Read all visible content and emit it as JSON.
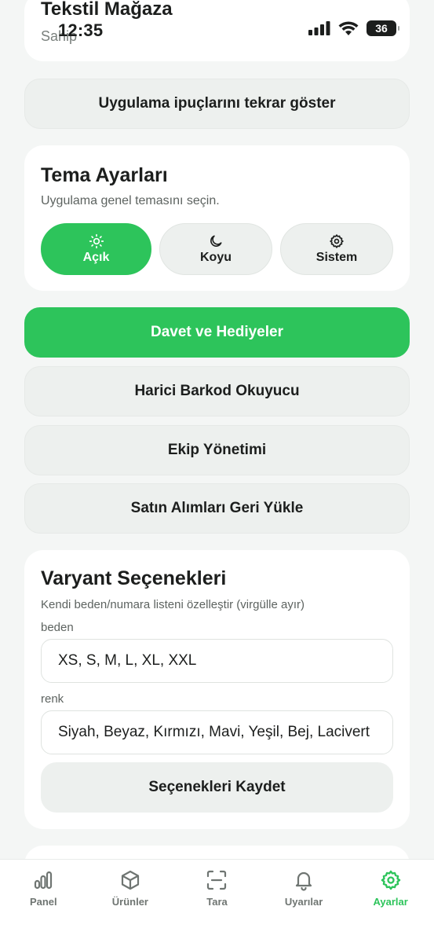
{
  "status": {
    "time": "12:35",
    "battery": "36"
  },
  "header": {
    "store_name": "Tekstil Mağaza",
    "role": "Sahip"
  },
  "tips_button": "Uygulama ipuçlarını tekrar göster",
  "theme": {
    "title": "Tema Ayarları",
    "subtitle": "Uygulama genel temasını seçin.",
    "options": [
      {
        "label": "Açık",
        "icon": "sun-icon",
        "selected": true
      },
      {
        "label": "Koyu",
        "icon": "moon-icon",
        "selected": false
      },
      {
        "label": "Sistem",
        "icon": "gear-icon",
        "selected": false
      }
    ]
  },
  "menu": {
    "invite": "Davet ve Hediyeler",
    "barcode": "Harici Barkod Okuyucu",
    "team": "Ekip Yönetimi",
    "restore": "Satın Alımları Geri Yükle"
  },
  "variants": {
    "title": "Varyant Seçenekleri",
    "subtitle": "Kendi beden/numara listeni özelleştir (virgülle ayır)",
    "size_label": "beden",
    "size_value": "XS, S, M, L, XL, XXL",
    "color_label": "renk",
    "color_value": "Siyah, Beyaz, Kırmızı, Mavi, Yeşil, Bej, Lacivert",
    "save_label": "Seçenekleri Kaydet"
  },
  "tabbar": [
    {
      "label": "Panel",
      "icon": "bar-chart-icon",
      "active": false
    },
    {
      "label": "Ürünler",
      "icon": "box-icon",
      "active": false
    },
    {
      "label": "Tara",
      "icon": "scan-icon",
      "active": false
    },
    {
      "label": "Uyarılar",
      "icon": "bell-icon",
      "active": false
    },
    {
      "label": "Ayarlar",
      "icon": "gear-icon",
      "active": true
    }
  ],
  "colors": {
    "accent": "#2dc45b",
    "background": "#f4f6f5",
    "button": "#edf0ee"
  }
}
